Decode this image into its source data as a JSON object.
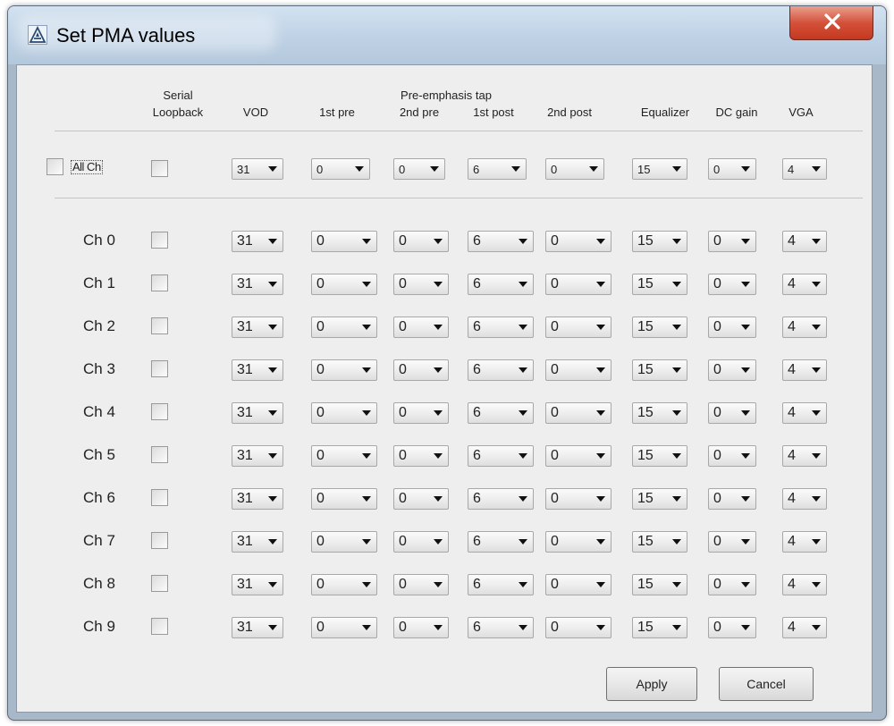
{
  "window": {
    "title": "Set PMA values",
    "close_glyph": "X"
  },
  "headers": {
    "serial_loopback": [
      "Serial",
      "Loopback"
    ],
    "pre_emphasis_group": "Pre-emphasis tap",
    "vod": "VOD",
    "pre1": "1st pre",
    "pre2": "2nd pre",
    "post1": "1st post",
    "post2": "2nd post",
    "equalizer": "Equalizer",
    "dc_gain": "DC gain",
    "vga": "VGA"
  },
  "all_row": {
    "label": "All Ch",
    "checked": false,
    "loopback": false,
    "values": {
      "vod": "31",
      "pre1": "0",
      "pre2": "0",
      "post1": "6",
      "post2": "0",
      "equalizer": "15",
      "dc_gain": "0",
      "vga": "4"
    }
  },
  "channels": [
    {
      "label": "Ch 0",
      "loopback": false,
      "values": {
        "vod": "31",
        "pre1": "0",
        "pre2": "0",
        "post1": "6",
        "post2": "0",
        "equalizer": "15",
        "dc_gain": "0",
        "vga": "4"
      }
    },
    {
      "label": "Ch 1",
      "loopback": false,
      "values": {
        "vod": "31",
        "pre1": "0",
        "pre2": "0",
        "post1": "6",
        "post2": "0",
        "equalizer": "15",
        "dc_gain": "0",
        "vga": "4"
      }
    },
    {
      "label": "Ch 2",
      "loopback": false,
      "values": {
        "vod": "31",
        "pre1": "0",
        "pre2": "0",
        "post1": "6",
        "post2": "0",
        "equalizer": "15",
        "dc_gain": "0",
        "vga": "4"
      }
    },
    {
      "label": "Ch 3",
      "loopback": false,
      "values": {
        "vod": "31",
        "pre1": "0",
        "pre2": "0",
        "post1": "6",
        "post2": "0",
        "equalizer": "15",
        "dc_gain": "0",
        "vga": "4"
      }
    },
    {
      "label": "Ch 4",
      "loopback": false,
      "values": {
        "vod": "31",
        "pre1": "0",
        "pre2": "0",
        "post1": "6",
        "post2": "0",
        "equalizer": "15",
        "dc_gain": "0",
        "vga": "4"
      }
    },
    {
      "label": "Ch 5",
      "loopback": false,
      "values": {
        "vod": "31",
        "pre1": "0",
        "pre2": "0",
        "post1": "6",
        "post2": "0",
        "equalizer": "15",
        "dc_gain": "0",
        "vga": "4"
      }
    },
    {
      "label": "Ch 6",
      "loopback": false,
      "values": {
        "vod": "31",
        "pre1": "0",
        "pre2": "0",
        "post1": "6",
        "post2": "0",
        "equalizer": "15",
        "dc_gain": "0",
        "vga": "4"
      }
    },
    {
      "label": "Ch 7",
      "loopback": false,
      "values": {
        "vod": "31",
        "pre1": "0",
        "pre2": "0",
        "post1": "6",
        "post2": "0",
        "equalizer": "15",
        "dc_gain": "0",
        "vga": "4"
      }
    },
    {
      "label": "Ch 8",
      "loopback": false,
      "values": {
        "vod": "31",
        "pre1": "0",
        "pre2": "0",
        "post1": "6",
        "post2": "0",
        "equalizer": "15",
        "dc_gain": "0",
        "vga": "4"
      }
    },
    {
      "label": "Ch 9",
      "loopback": false,
      "values": {
        "vod": "31",
        "pre1": "0",
        "pre2": "0",
        "post1": "6",
        "post2": "0",
        "equalizer": "15",
        "dc_gain": "0",
        "vga": "4"
      }
    }
  ],
  "buttons": {
    "apply": "Apply",
    "cancel": "Cancel"
  },
  "icons": {
    "app": "altera-a-icon",
    "close": "close-x-icon"
  },
  "colors": {
    "close_button": "#c5381f",
    "titlebar": "#c0d3e6",
    "client_bg": "#eeeeee"
  }
}
